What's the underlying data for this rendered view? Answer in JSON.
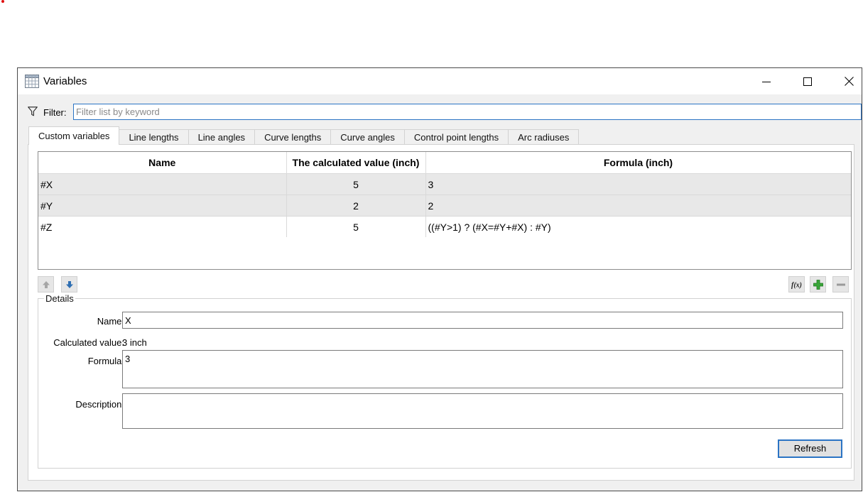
{
  "window": {
    "title": "Variables",
    "icon": "table-grid-icon",
    "controls": [
      "minimize-icon",
      "maximize-icon",
      "close-icon"
    ]
  },
  "filter": {
    "label": "Filter:",
    "placeholder": "Filter list by keyword",
    "value": ""
  },
  "tabs": [
    {
      "label": "Custom variables",
      "active": true
    },
    {
      "label": "Line lengths",
      "active": false
    },
    {
      "label": "Line angles",
      "active": false
    },
    {
      "label": "Curve lengths",
      "active": false
    },
    {
      "label": "Curve angles",
      "active": false
    },
    {
      "label": "Control point lengths",
      "active": false
    },
    {
      "label": "Arc radiuses",
      "active": false
    }
  ],
  "table": {
    "columns": [
      "Name",
      "The calculated value (inch)",
      "Formula (inch)"
    ],
    "rows": [
      {
        "name": "#X",
        "value": "5",
        "formula": "3",
        "selected": true
      },
      {
        "name": "#Y",
        "value": "2",
        "formula": "2",
        "selected": true
      },
      {
        "name": "#Z",
        "value": "5",
        "formula": "((#Y>1) ? (#X=#Y+#X) : #Y)",
        "selected": false
      }
    ]
  },
  "toolbar": {
    "left": [
      "move-up-icon",
      "move-down-icon"
    ],
    "right": [
      "function-icon",
      "add-icon",
      "remove-icon"
    ]
  },
  "details": {
    "legend": "Details",
    "name_label": "Name:",
    "name_value": "X",
    "calc_label": "Calculated value:",
    "calc_value": "3 inch",
    "formula_label": "Formula:",
    "formula_value": "3",
    "description_label": "Description:",
    "description_value": "",
    "refresh_label": "Refresh"
  },
  "colors": {
    "accent": "#2b74c4",
    "selection_row": "#e8e8e8",
    "add_green": "#3aa63a",
    "arrow_blue": "#2f6fb3"
  }
}
